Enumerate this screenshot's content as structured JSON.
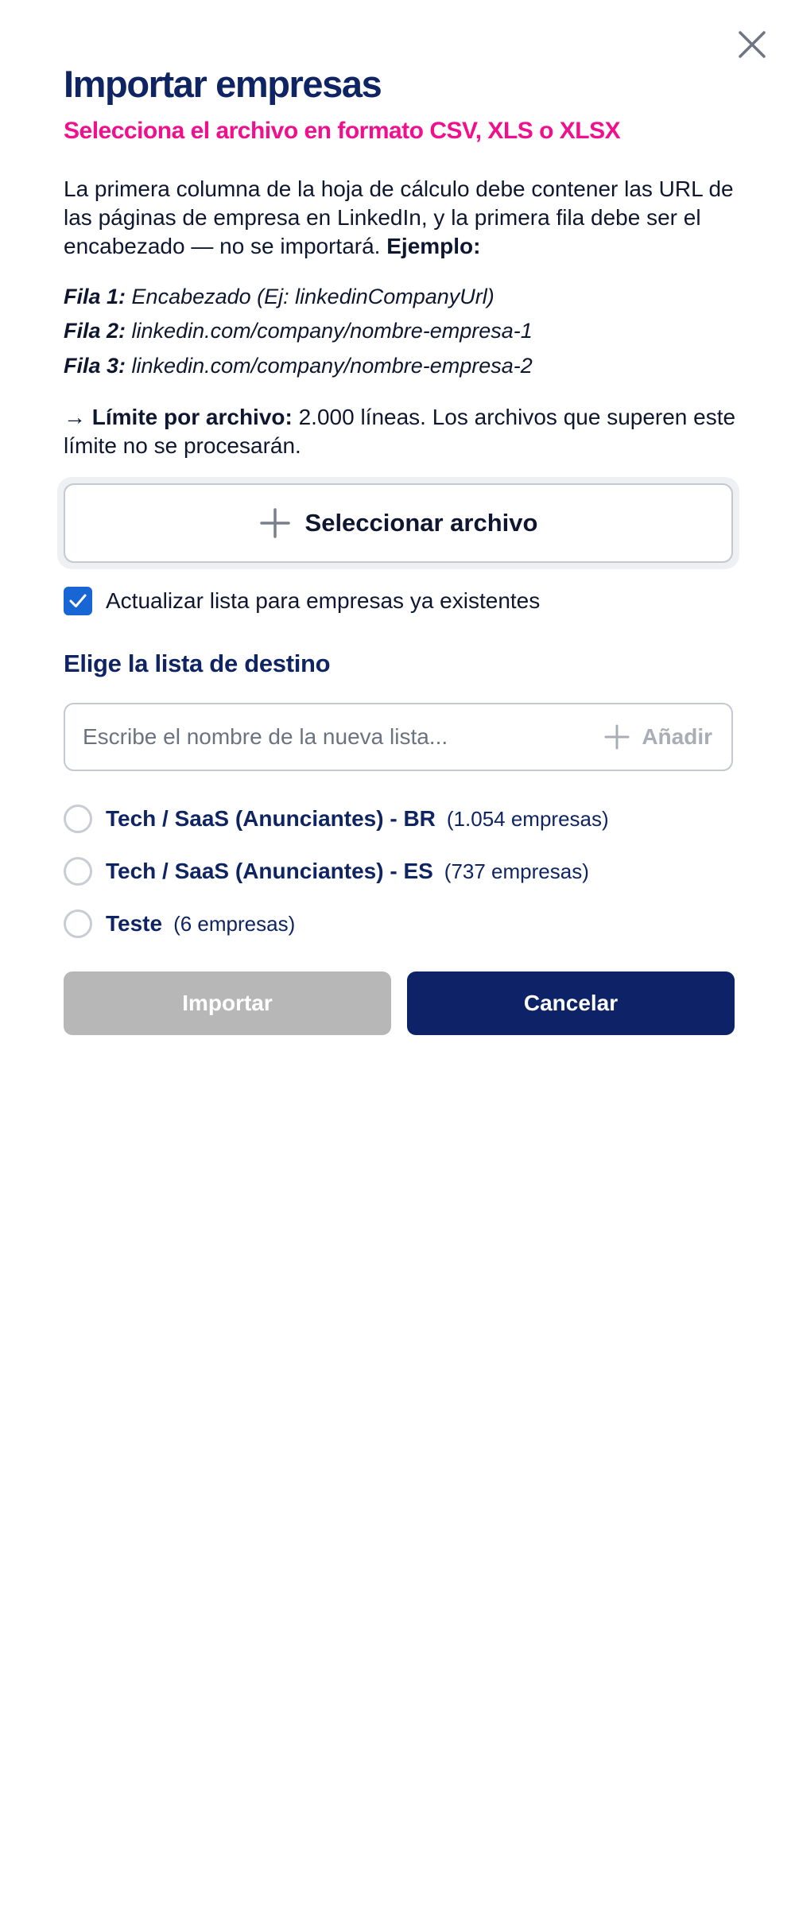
{
  "modal": {
    "title": "Importar empresas",
    "subtitle": "Selecciona el archivo en formato CSV, XLS o XLSX",
    "description": "La primera columna de la hoja de cálculo debe contener las URL de las páginas de empresa en LinkedIn, y la primera fila debe ser el encabezado — no se importará.",
    "description_example_label": "Ejemplo:",
    "examples": [
      {
        "label": "Fila 1:",
        "value": "Encabezado (Ej: linkedinCompanyUrl)"
      },
      {
        "label": "Fila 2:",
        "value": "linkedin.com/company/nombre-empresa-1"
      },
      {
        "label": "Fila 3:",
        "value": "linkedin.com/company/nombre-empresa-2"
      }
    ],
    "limit": {
      "arrow": "→",
      "label": "Límite por archivo:",
      "text": "2.000 líneas. Los archivos que superen este límite no se procesarán."
    },
    "select_file_label": "Seleccionar archivo",
    "update_checkbox": {
      "label": "Actualizar lista para empresas ya existentes",
      "checked": true
    },
    "destination_title": "Elige la lista de destino",
    "new_list": {
      "placeholder": "Escribe el nombre de la nueva lista...",
      "value": "",
      "add_label": "Añadir"
    },
    "lists": [
      {
        "name": "Tech / SaaS (Anunciantes) - BR",
        "count": "(1.054 empresas)",
        "selected": false
      },
      {
        "name": "Tech / SaaS (Anunciantes) - ES",
        "count": "(737 empresas)",
        "selected": false
      },
      {
        "name": "Teste",
        "count": "(6 empresas)",
        "selected": false
      }
    ],
    "buttons": {
      "import": "Importar",
      "cancel": "Cancelar"
    },
    "icons": {
      "close": "close-icon",
      "select_file": "plus-icon",
      "checkbox": "checkmark-icon",
      "add": "plus-icon"
    },
    "colors": {
      "title": "#0f2463",
      "subtitle": "#f00f8c",
      "checkbox": "#1865d6",
      "import_disabled": "#b7b7b7",
      "cancel": "#0e2267"
    }
  }
}
